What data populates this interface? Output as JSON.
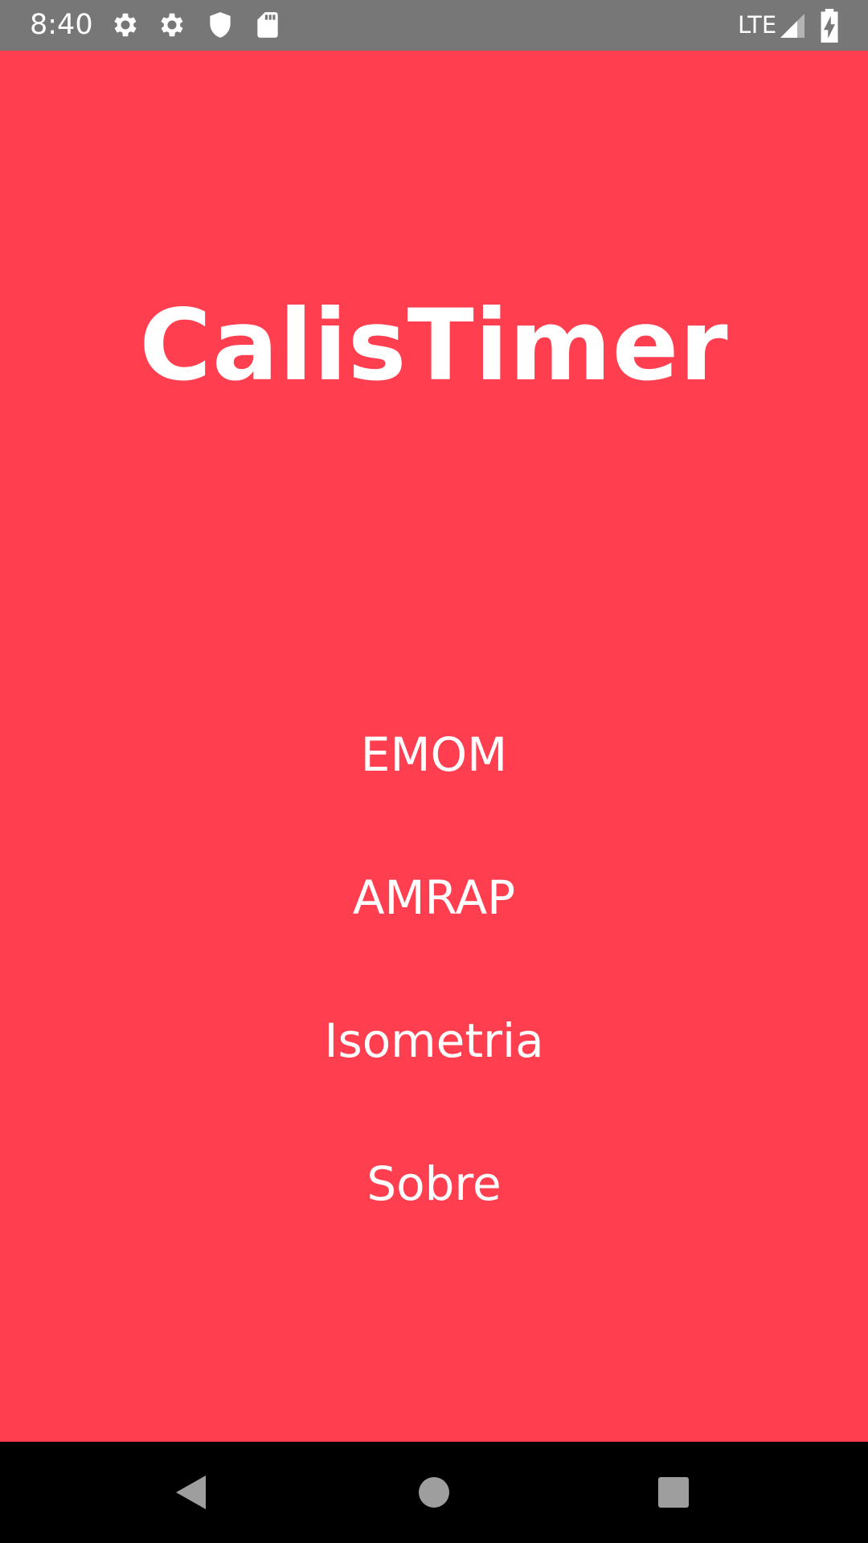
{
  "status_bar": {
    "time": "8:40",
    "network": "LTE",
    "icons": [
      "gear-icon",
      "gear-icon",
      "shield-icon",
      "sd-card-icon",
      "signal-icon",
      "battery-charging-icon"
    ]
  },
  "app": {
    "title": "CalisTimer",
    "background_color": "#FF3F4F",
    "text_color": "#FFFFFF"
  },
  "menu": {
    "items": [
      {
        "label": "EMOM"
      },
      {
        "label": "AMRAP"
      },
      {
        "label": "Isometria"
      },
      {
        "label": "Sobre"
      }
    ]
  },
  "nav_bar": {
    "buttons": [
      "back-icon",
      "home-icon",
      "recents-icon"
    ]
  }
}
